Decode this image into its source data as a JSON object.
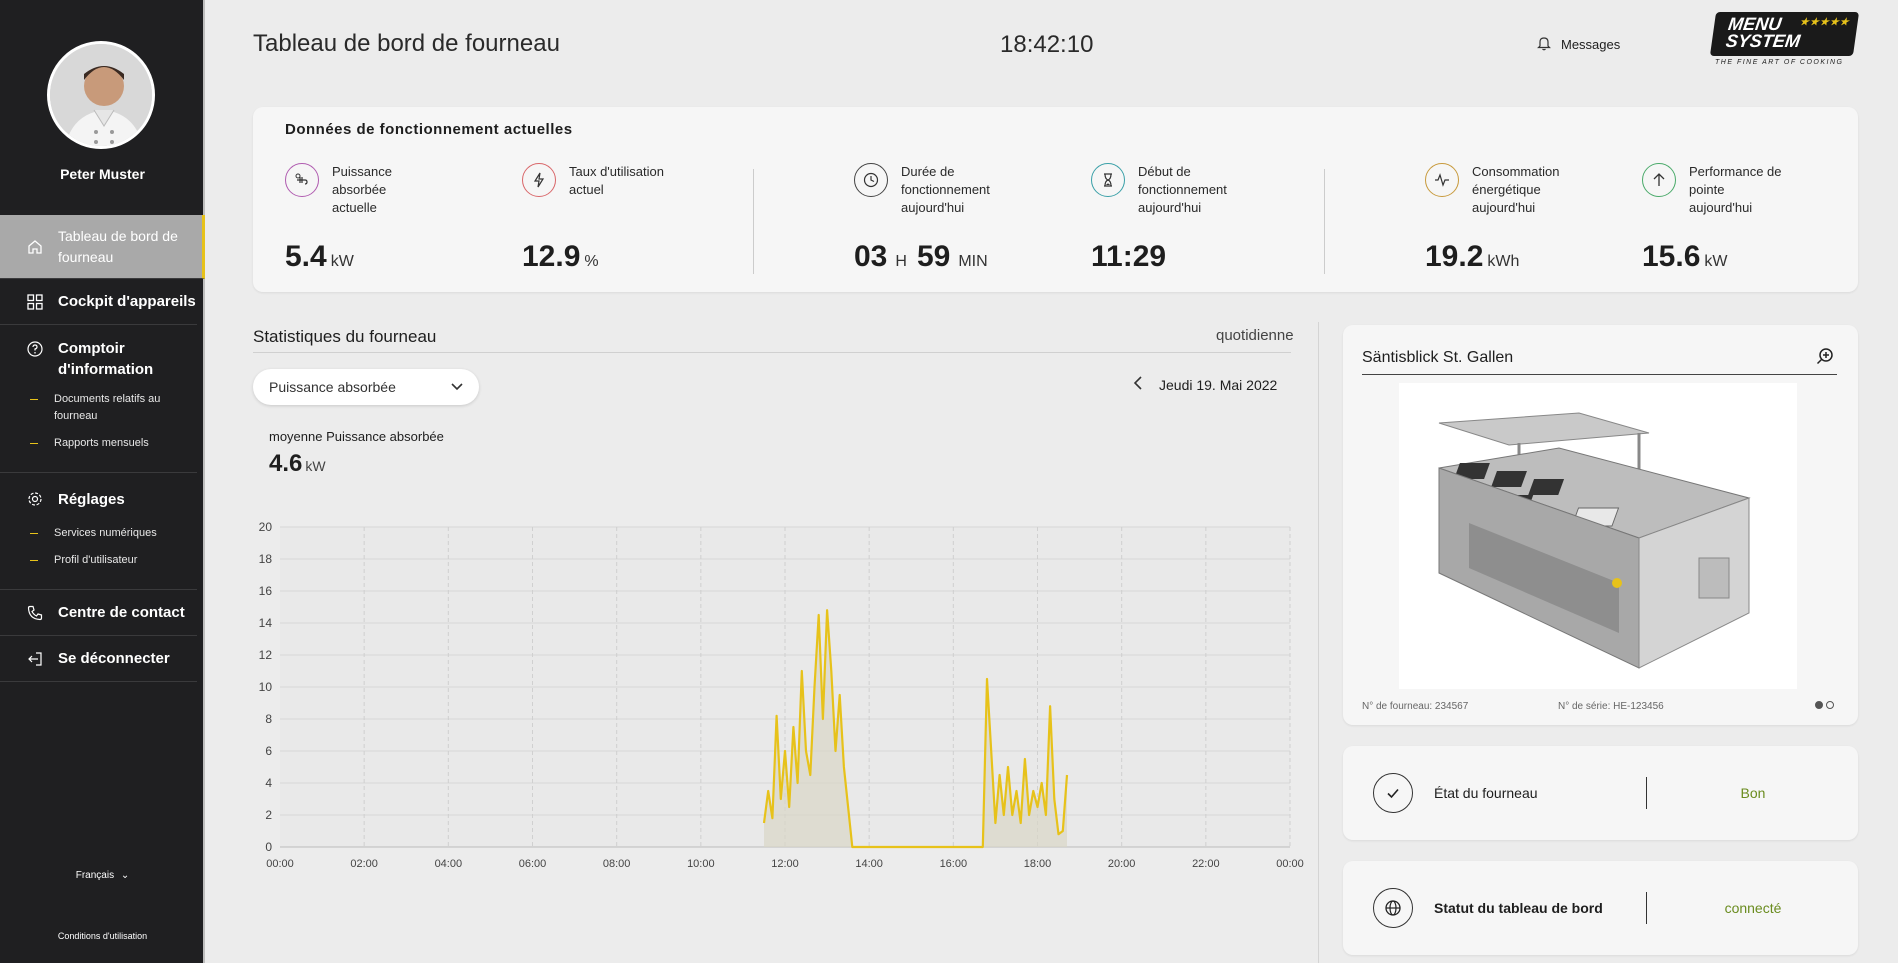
{
  "sidebar": {
    "user_name": "Peter Muster",
    "nav": {
      "dashboard": "Tableau de bord de fourneau",
      "cockpit": "Cockpit d'appareils",
      "info": "Comptoir d'information",
      "info_sub": [
        "Documents relatifs au fourneau",
        "Rapports mensuels"
      ],
      "settings": "Réglages",
      "settings_sub": [
        "Services numériques",
        "Profil d'utilisateur"
      ],
      "contact": "Centre de contact",
      "logout": "Se déconnecter"
    },
    "language": "Français",
    "terms": "Conditions d'utilisation"
  },
  "header": {
    "title": "Tableau de bord de fourneau",
    "clock": "18:42:10",
    "messages": "Messages",
    "logo_text_1": "MENU",
    "logo_text_2": "SYSTEM",
    "logo_stars": "★★★★★",
    "logo_tagline": "THE FINE ART OF COOKING"
  },
  "current": {
    "title": "Données de fonctionnement actuelles",
    "metrics": [
      {
        "label": "Puissance absorbée actuelle",
        "value": "5.4",
        "unit": "kW",
        "color": "#b05cb0"
      },
      {
        "label": "Taux d'utilisation actuel",
        "value": "12.9",
        "unit": "%",
        "color": "#d9676a"
      },
      {
        "label": "Durée de fonctionnement aujourd'hui",
        "hours": "03",
        "h_unit": "H",
        "minutes": "59",
        "m_unit": "MIN",
        "color": "#444444"
      },
      {
        "label": "Début de fonctionnement aujourd'hui",
        "value": "11:29",
        "color": "#3aa0a8"
      },
      {
        "label": "Consommation énergétique aujourd'hui",
        "value": "19.2",
        "unit": "kWh",
        "color": "#c89a3c"
      },
      {
        "label": "Performance de pointe aujourd'hui",
        "value": "15.6",
        "unit": "kW",
        "color": "#4aaa6a"
      }
    ]
  },
  "stats": {
    "title": "Statistiques du fourneau",
    "frequency": "quotidienne",
    "dropdown_value": "Puissance absorbée",
    "date": "Jeudi 19. Mai 2022",
    "avg_label": "moyenne Puissance absorbée",
    "avg_value": "4.6",
    "avg_unit": "kW"
  },
  "chart_data": {
    "type": "area",
    "title": "",
    "xlabel": "",
    "ylabel": "",
    "x_ticks": [
      "00:00",
      "02:00",
      "04:00",
      "06:00",
      "08:00",
      "10:00",
      "12:00",
      "14:00",
      "16:00",
      "18:00",
      "20:00",
      "22:00",
      "00:00"
    ],
    "y_ticks": [
      0,
      2,
      4,
      6,
      8,
      10,
      12,
      14,
      16,
      18,
      20
    ],
    "ylim": [
      0,
      20
    ],
    "xlim_hours": [
      0,
      24
    ],
    "grid": true,
    "color": "#e7c21a",
    "x_hours": [
      11.5,
      11.6,
      11.7,
      11.8,
      11.9,
      12.0,
      12.1,
      12.2,
      12.3,
      12.4,
      12.5,
      12.6,
      12.7,
      12.8,
      12.9,
      13.0,
      13.1,
      13.2,
      13.3,
      13.4,
      13.5,
      13.6,
      13.7,
      13.8,
      13.9,
      14.0,
      14.1,
      15.0,
      16.0,
      16.7,
      16.8,
      16.9,
      17.0,
      17.1,
      17.2,
      17.3,
      17.4,
      17.5,
      17.6,
      17.7,
      17.8,
      17.9,
      18.0,
      18.1,
      18.2,
      18.3,
      18.4,
      18.5,
      18.6,
      18.7
    ],
    "values": [
      1.5,
      3.5,
      1.8,
      8.2,
      3.0,
      6.0,
      2.5,
      7.5,
      4.0,
      11.0,
      6.0,
      4.5,
      10.0,
      14.5,
      8.0,
      14.8,
      11.0,
      6.0,
      9.5,
      5.0,
      2.5,
      0.0,
      0.0,
      0.0,
      0.0,
      0.0,
      0.0,
      0.0,
      0.0,
      0.0,
      10.5,
      6.0,
      1.5,
      4.5,
      2.0,
      5.0,
      2.0,
      3.5,
      1.5,
      5.5,
      2.0,
      3.5,
      2.5,
      4.0,
      2.0,
      8.8,
      3.0,
      0.8,
      1.0,
      4.5
    ]
  },
  "kitchen": {
    "title": "Säntisblick St. Gallen",
    "stove_no": "N° de fourneau: 234567",
    "serial_no": "N° de série: HE-123456"
  },
  "status": [
    {
      "label": "État du fourneau",
      "value": "Bon"
    },
    {
      "label": "Statut du tableau de bord",
      "value": "connecté"
    }
  ]
}
